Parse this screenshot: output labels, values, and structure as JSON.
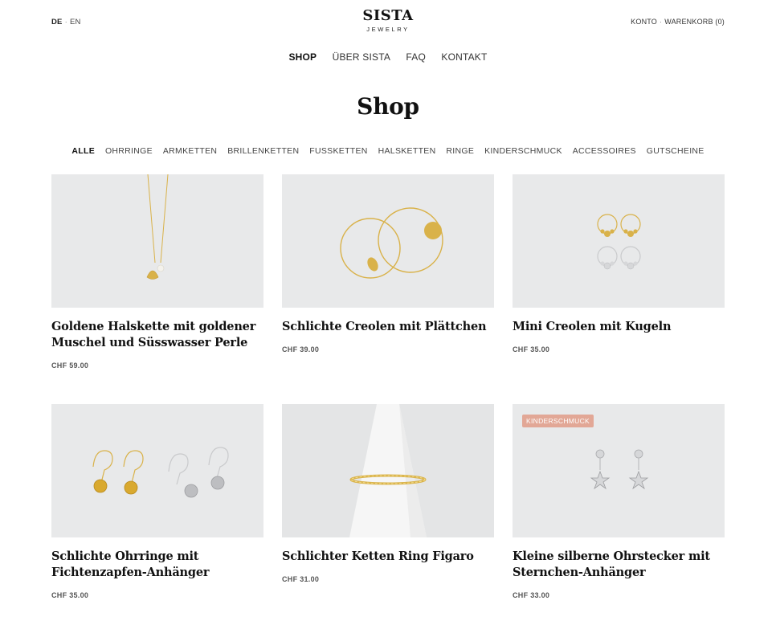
{
  "header": {
    "lang_active": "DE",
    "lang_other": "EN",
    "brand": "SISTA",
    "brand_sub": "JEWELRY",
    "account": "KONTO",
    "cart": "WARENKORB (0)"
  },
  "main_nav": [
    "SHOP",
    "ÜBER SISTA",
    "FAQ",
    "KONTAKT"
  ],
  "page_title": "Shop",
  "categories": [
    "ALLE",
    "OHRRINGE",
    "ARMKETTEN",
    "BRILLENKETTEN",
    "FUSSKETTEN",
    "HALSKETTEN",
    "RINGE",
    "KINDERSCHMUCK",
    "ACCESSOIRES",
    "GUTSCHEINE"
  ],
  "products": [
    {
      "title": "Goldene Halskette mit goldener Muschel und Süsswasser Perle",
      "price": "CHF 59.00",
      "badge": ""
    },
    {
      "title": "Schlichte Creolen mit Plättchen",
      "price": "CHF 39.00",
      "badge": ""
    },
    {
      "title": "Mini Creolen mit Kugeln",
      "price": "CHF 35.00",
      "badge": ""
    },
    {
      "title": "Schlichte Ohrringe mit Fichtenzapfen-Anhänger",
      "price": "CHF 35.00",
      "badge": ""
    },
    {
      "title": "Schlichter Ketten Ring Figaro",
      "price": "CHF 31.00",
      "badge": ""
    },
    {
      "title": "Kleine silberne Ohrstecker mit Sternchen-Anhänger",
      "price": "CHF 33.00",
      "badge": "KINDERSCHMUCK"
    }
  ],
  "colors": {
    "gold": "#d9b24a",
    "silver": "#c9cacc",
    "thumb_bg": "#e8e9ea",
    "badge": "#e2a796"
  }
}
